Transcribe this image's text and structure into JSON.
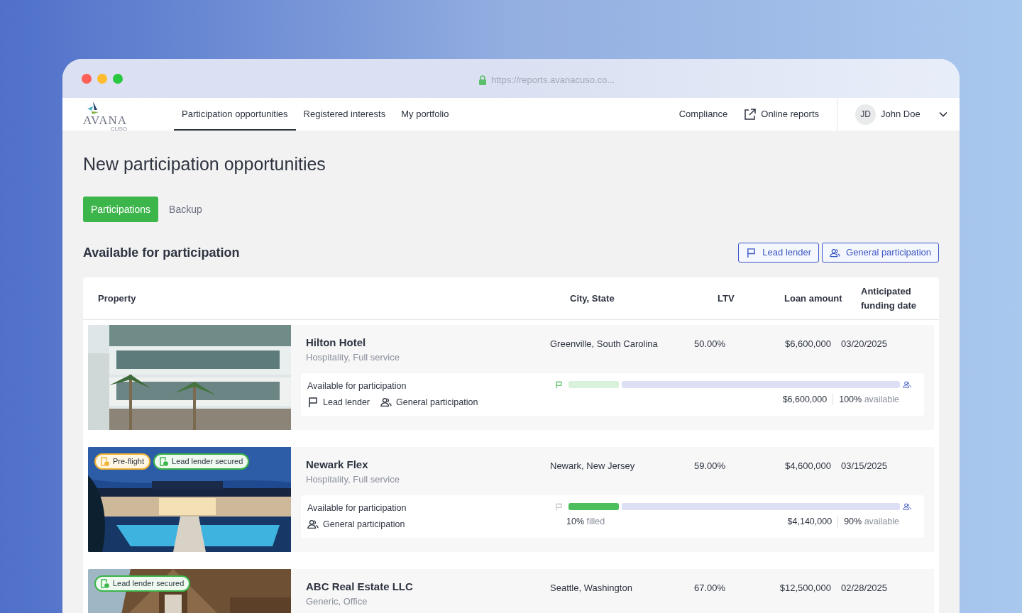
{
  "browser": {
    "url": "https://reports.avanacuso.co..."
  },
  "logo": {
    "name": "AVANA",
    "sub": "CUSO"
  },
  "nav": [
    {
      "label": "Participation opportunities",
      "selected": true
    },
    {
      "label": "Registered interests",
      "selected": false
    },
    {
      "label": "My portfolio",
      "selected": false
    }
  ],
  "nav_right": [
    {
      "label": "Compliance",
      "kind": "plain"
    },
    {
      "label": "Online reports",
      "kind": "external"
    }
  ],
  "user": {
    "initials": "JD",
    "name": "John Doe"
  },
  "page_title": "New participation opportunities",
  "tabs": [
    {
      "label": "Participations",
      "selected": true
    },
    {
      "label": "Backup",
      "selected": false
    }
  ],
  "section_title": "Available for participation",
  "filters": [
    {
      "label": "Lead lender",
      "kind": "lead",
      "selected": true
    },
    {
      "label": "General participation",
      "kind": "general",
      "selected": true
    }
  ],
  "table": {
    "columns": [
      "Property",
      "City, State",
      "LTV",
      "Loan amount",
      "Anticipated funding date"
    ],
    "rows": [
      {
        "name": "Hilton Hotel",
        "category": "Hospitality, Full service",
        "city": "Greenville, South Carolina",
        "ltv": "50.00%",
        "amount": "$6,600,000",
        "date": "03/20/2025",
        "badges": [],
        "status": "Available for participation",
        "types": [
          {
            "label": "Lead lender",
            "kind": "lead"
          },
          {
            "label": "General participation",
            "kind": "general"
          }
        ],
        "lead_filled": false,
        "filled": null,
        "available_amount": "$6,600,000",
        "available_pct": "100%",
        "available_word": "available"
      },
      {
        "name": "Newark Flex",
        "category": "Hospitality, Full service",
        "city": "Newark, New Jersey",
        "ltv": "59.00%",
        "amount": "$4,600,000",
        "date": "03/15/2025",
        "badges": [
          {
            "label": "Pre-flight",
            "kind": "preflight"
          },
          {
            "label": "Lead lender secured",
            "kind": "secured"
          }
        ],
        "status": "Available for participation",
        "types": [
          {
            "label": "General participation",
            "kind": "general"
          }
        ],
        "lead_filled": true,
        "filled": {
          "pct": "10%",
          "word": "filled"
        },
        "available_amount": "$4,140,000",
        "available_pct": "90%",
        "available_word": "available"
      },
      {
        "name": "ABC Real Estate LLC",
        "category": "Generic, Office",
        "city": "Seattle, Washington",
        "ltv": "67.00%",
        "amount": "$12,500,000",
        "date": "02/28/2025",
        "badges": [
          {
            "label": "Lead lender secured",
            "kind": "secured"
          }
        ]
      }
    ]
  }
}
